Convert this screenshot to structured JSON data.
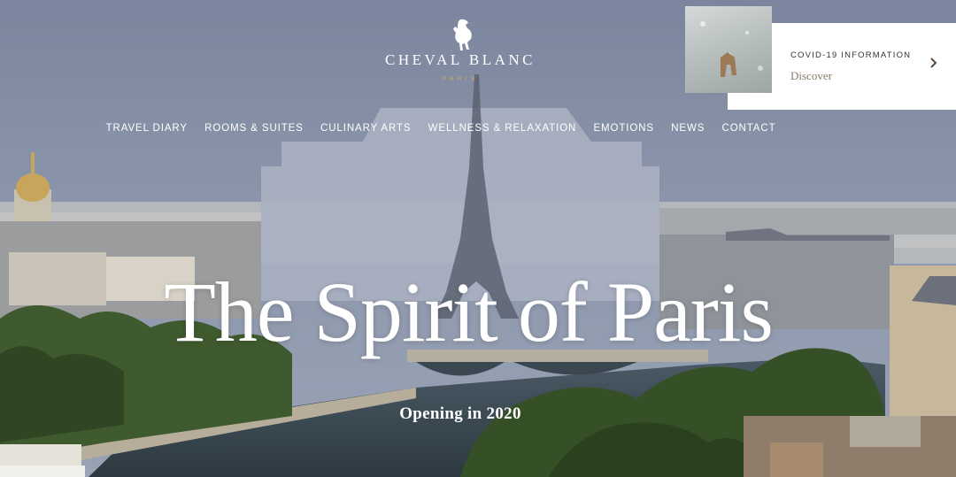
{
  "brand": {
    "name": "CHEVAL BLANC",
    "subname": "PARIS"
  },
  "nav": {
    "items": [
      {
        "label": "TRAVEL DIARY"
      },
      {
        "label": "ROOMS & SUITES"
      },
      {
        "label": "CULINARY ARTS"
      },
      {
        "label": "WELLNESS & RELAXATION"
      },
      {
        "label": "EMOTIONS"
      },
      {
        "label": "NEWS"
      },
      {
        "label": "CONTACT"
      }
    ]
  },
  "covid_card": {
    "title": "COVID-19 INFORMATION",
    "link": "Discover",
    "icon": "chevron-right-icon"
  },
  "hero": {
    "headline": "The Spirit of Paris",
    "subtitle": "Opening in 2020"
  },
  "colors": {
    "sky": "#7f8aa0",
    "gold": "#c9a865",
    "card_text": "#333333",
    "link_text": "#8a7d6a"
  }
}
